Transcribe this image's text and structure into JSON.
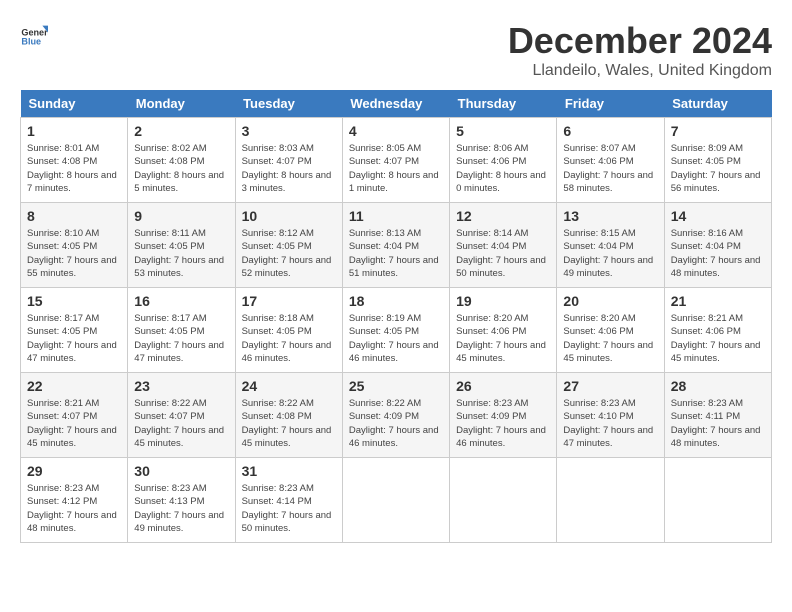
{
  "header": {
    "logo_line1": "General",
    "logo_line2": "Blue",
    "title": "December 2024",
    "subtitle": "Llandeilo, Wales, United Kingdom"
  },
  "days_of_week": [
    "Sunday",
    "Monday",
    "Tuesday",
    "Wednesday",
    "Thursday",
    "Friday",
    "Saturday"
  ],
  "weeks": [
    [
      {
        "day": "1",
        "sunrise": "Sunrise: 8:01 AM",
        "sunset": "Sunset: 4:08 PM",
        "daylight": "Daylight: 8 hours and 7 minutes."
      },
      {
        "day": "2",
        "sunrise": "Sunrise: 8:02 AM",
        "sunset": "Sunset: 4:08 PM",
        "daylight": "Daylight: 8 hours and 5 minutes."
      },
      {
        "day": "3",
        "sunrise": "Sunrise: 8:03 AM",
        "sunset": "Sunset: 4:07 PM",
        "daylight": "Daylight: 8 hours and 3 minutes."
      },
      {
        "day": "4",
        "sunrise": "Sunrise: 8:05 AM",
        "sunset": "Sunset: 4:07 PM",
        "daylight": "Daylight: 8 hours and 1 minute."
      },
      {
        "day": "5",
        "sunrise": "Sunrise: 8:06 AM",
        "sunset": "Sunset: 4:06 PM",
        "daylight": "Daylight: 8 hours and 0 minutes."
      },
      {
        "day": "6",
        "sunrise": "Sunrise: 8:07 AM",
        "sunset": "Sunset: 4:06 PM",
        "daylight": "Daylight: 7 hours and 58 minutes."
      },
      {
        "day": "7",
        "sunrise": "Sunrise: 8:09 AM",
        "sunset": "Sunset: 4:05 PM",
        "daylight": "Daylight: 7 hours and 56 minutes."
      }
    ],
    [
      {
        "day": "8",
        "sunrise": "Sunrise: 8:10 AM",
        "sunset": "Sunset: 4:05 PM",
        "daylight": "Daylight: 7 hours and 55 minutes."
      },
      {
        "day": "9",
        "sunrise": "Sunrise: 8:11 AM",
        "sunset": "Sunset: 4:05 PM",
        "daylight": "Daylight: 7 hours and 53 minutes."
      },
      {
        "day": "10",
        "sunrise": "Sunrise: 8:12 AM",
        "sunset": "Sunset: 4:05 PM",
        "daylight": "Daylight: 7 hours and 52 minutes."
      },
      {
        "day": "11",
        "sunrise": "Sunrise: 8:13 AM",
        "sunset": "Sunset: 4:04 PM",
        "daylight": "Daylight: 7 hours and 51 minutes."
      },
      {
        "day": "12",
        "sunrise": "Sunrise: 8:14 AM",
        "sunset": "Sunset: 4:04 PM",
        "daylight": "Daylight: 7 hours and 50 minutes."
      },
      {
        "day": "13",
        "sunrise": "Sunrise: 8:15 AM",
        "sunset": "Sunset: 4:04 PM",
        "daylight": "Daylight: 7 hours and 49 minutes."
      },
      {
        "day": "14",
        "sunrise": "Sunrise: 8:16 AM",
        "sunset": "Sunset: 4:04 PM",
        "daylight": "Daylight: 7 hours and 48 minutes."
      }
    ],
    [
      {
        "day": "15",
        "sunrise": "Sunrise: 8:17 AM",
        "sunset": "Sunset: 4:05 PM",
        "daylight": "Daylight: 7 hours and 47 minutes."
      },
      {
        "day": "16",
        "sunrise": "Sunrise: 8:17 AM",
        "sunset": "Sunset: 4:05 PM",
        "daylight": "Daylight: 7 hours and 47 minutes."
      },
      {
        "day": "17",
        "sunrise": "Sunrise: 8:18 AM",
        "sunset": "Sunset: 4:05 PM",
        "daylight": "Daylight: 7 hours and 46 minutes."
      },
      {
        "day": "18",
        "sunrise": "Sunrise: 8:19 AM",
        "sunset": "Sunset: 4:05 PM",
        "daylight": "Daylight: 7 hours and 46 minutes."
      },
      {
        "day": "19",
        "sunrise": "Sunrise: 8:20 AM",
        "sunset": "Sunset: 4:06 PM",
        "daylight": "Daylight: 7 hours and 45 minutes."
      },
      {
        "day": "20",
        "sunrise": "Sunrise: 8:20 AM",
        "sunset": "Sunset: 4:06 PM",
        "daylight": "Daylight: 7 hours and 45 minutes."
      },
      {
        "day": "21",
        "sunrise": "Sunrise: 8:21 AM",
        "sunset": "Sunset: 4:06 PM",
        "daylight": "Daylight: 7 hours and 45 minutes."
      }
    ],
    [
      {
        "day": "22",
        "sunrise": "Sunrise: 8:21 AM",
        "sunset": "Sunset: 4:07 PM",
        "daylight": "Daylight: 7 hours and 45 minutes."
      },
      {
        "day": "23",
        "sunrise": "Sunrise: 8:22 AM",
        "sunset": "Sunset: 4:07 PM",
        "daylight": "Daylight: 7 hours and 45 minutes."
      },
      {
        "day": "24",
        "sunrise": "Sunrise: 8:22 AM",
        "sunset": "Sunset: 4:08 PM",
        "daylight": "Daylight: 7 hours and 45 minutes."
      },
      {
        "day": "25",
        "sunrise": "Sunrise: 8:22 AM",
        "sunset": "Sunset: 4:09 PM",
        "daylight": "Daylight: 7 hours and 46 minutes."
      },
      {
        "day": "26",
        "sunrise": "Sunrise: 8:23 AM",
        "sunset": "Sunset: 4:09 PM",
        "daylight": "Daylight: 7 hours and 46 minutes."
      },
      {
        "day": "27",
        "sunrise": "Sunrise: 8:23 AM",
        "sunset": "Sunset: 4:10 PM",
        "daylight": "Daylight: 7 hours and 47 minutes."
      },
      {
        "day": "28",
        "sunrise": "Sunrise: 8:23 AM",
        "sunset": "Sunset: 4:11 PM",
        "daylight": "Daylight: 7 hours and 48 minutes."
      }
    ],
    [
      {
        "day": "29",
        "sunrise": "Sunrise: 8:23 AM",
        "sunset": "Sunset: 4:12 PM",
        "daylight": "Daylight: 7 hours and 48 minutes."
      },
      {
        "day": "30",
        "sunrise": "Sunrise: 8:23 AM",
        "sunset": "Sunset: 4:13 PM",
        "daylight": "Daylight: 7 hours and 49 minutes."
      },
      {
        "day": "31",
        "sunrise": "Sunrise: 8:23 AM",
        "sunset": "Sunset: 4:14 PM",
        "daylight": "Daylight: 7 hours and 50 minutes."
      },
      null,
      null,
      null,
      null
    ]
  ]
}
